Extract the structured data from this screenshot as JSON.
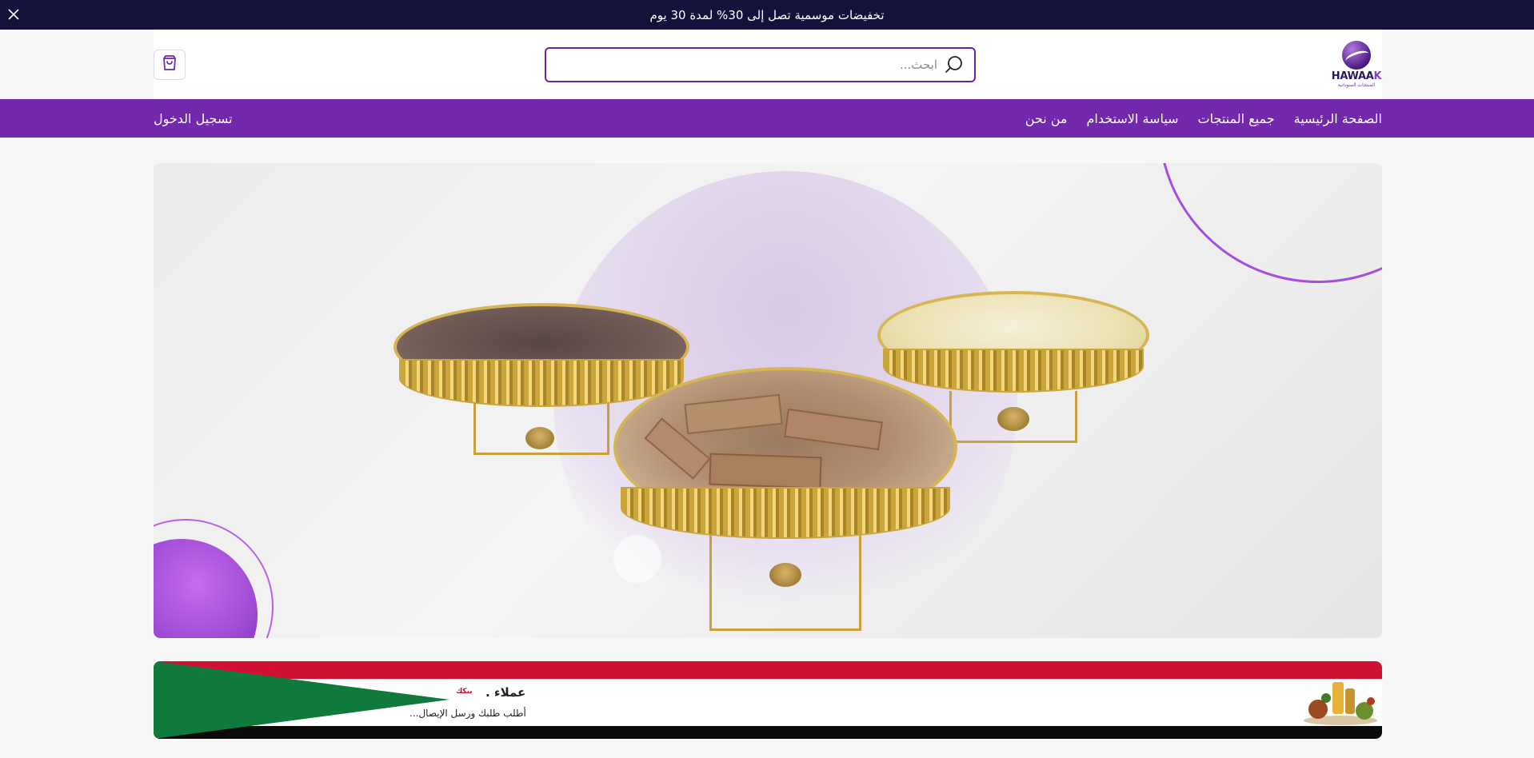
{
  "announcement": {
    "text": "تخفيضات موسمية تصل إلى 30% لمدة 30 يوم",
    "close_icon": "close-icon"
  },
  "header": {
    "logo": {
      "brand_main": "HAWAA",
      "brand_accent": "K",
      "subtitle": "المنتجات السودانية"
    },
    "search": {
      "placeholder": "ابحث...",
      "value": "",
      "icon": "search-icon"
    },
    "cart_icon": "shopping-bag-icon"
  },
  "nav": {
    "links": [
      {
        "label": "الصفحة الرئيسية"
      },
      {
        "label": "جميع المنتجات"
      },
      {
        "label": "سياسة الاستخدام"
      },
      {
        "label": "من نحن"
      }
    ],
    "login_label": "تسجيل الدخول"
  },
  "banner": {
    "brand_name": "بنكك",
    "headline": "عملاء .",
    "subline": "أطلب طلبك ورسل الإيصال..."
  },
  "colors": {
    "announcement_bg": "#14123a",
    "nav_bg": "#7228ab",
    "search_border": "#6b24a8"
  }
}
